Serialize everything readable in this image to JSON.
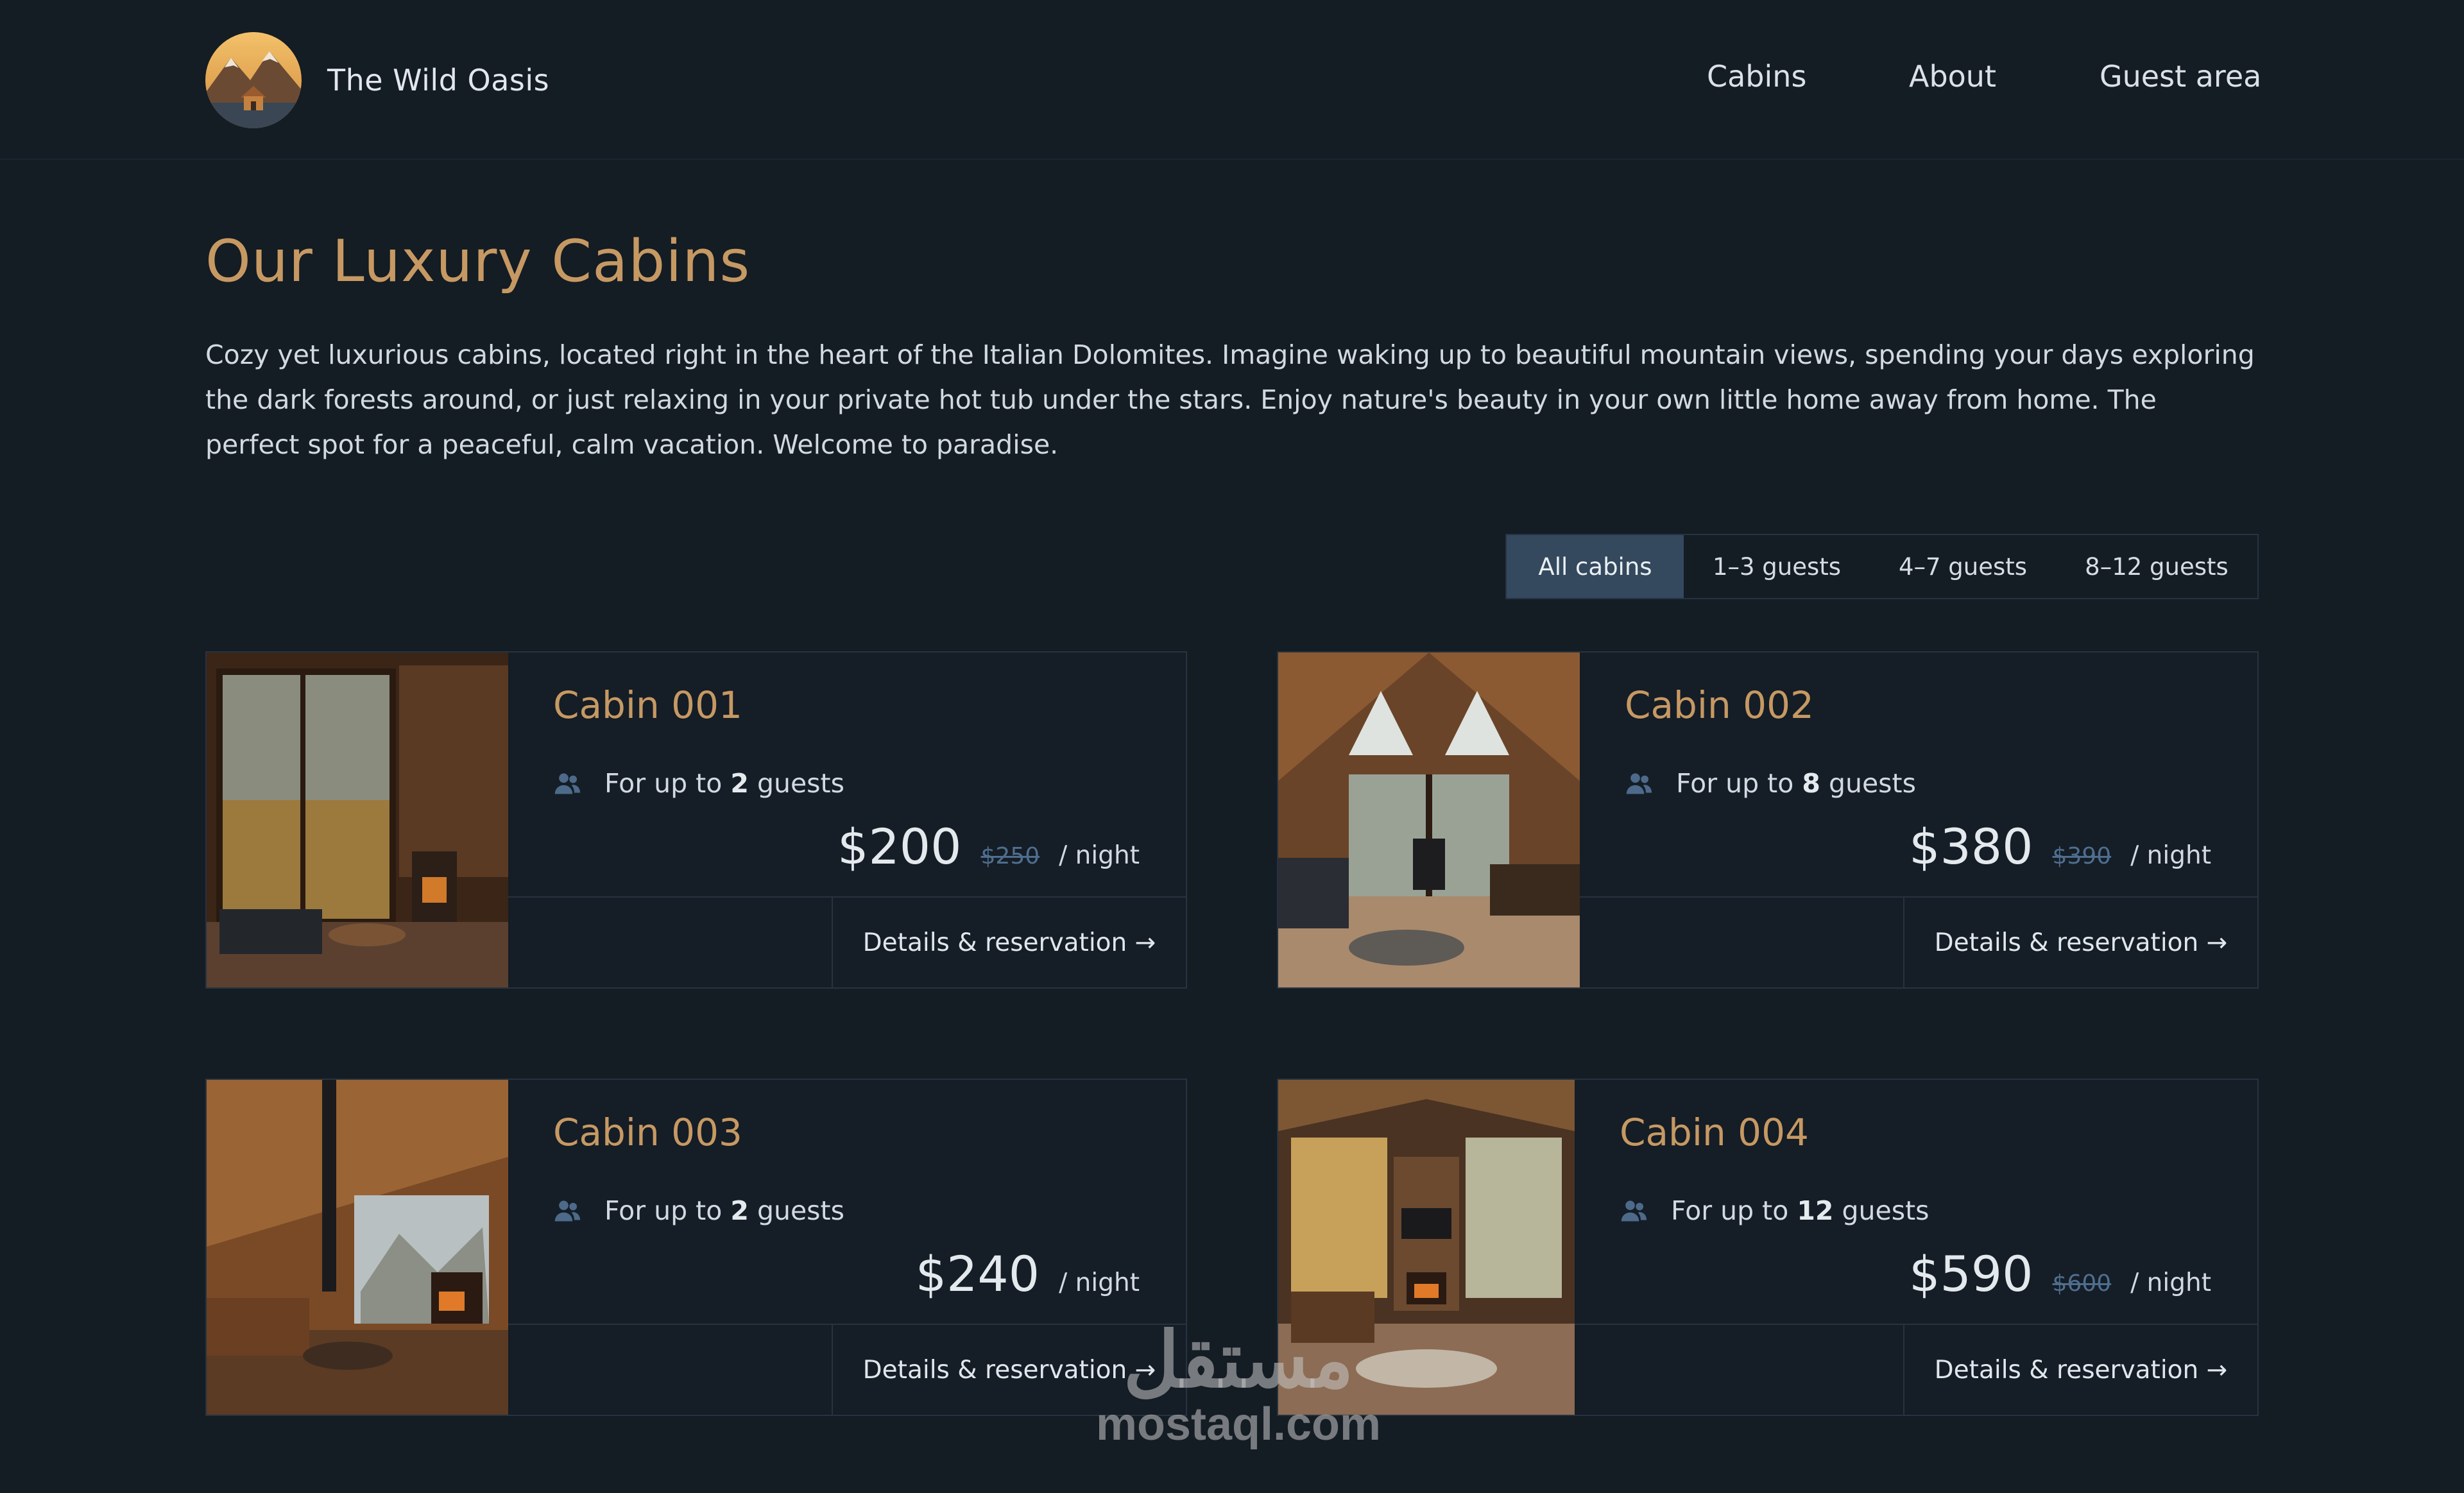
{
  "header": {
    "brand": "The Wild Oasis",
    "nav": {
      "cabins": "Cabins",
      "about": "About",
      "guest_area": "Guest area"
    }
  },
  "intro": {
    "title": "Our Luxury Cabins",
    "text": "Cozy yet luxurious cabins, located right in the heart of the Italian Dolomites. Imagine waking up to beautiful mountain views, spending your days exploring the dark forests around, or just relaxing in your private hot tub under the stars. Enjoy nature's beauty in your own little home away from home. The perfect spot for a peaceful, calm vacation. Welcome to paradise."
  },
  "filter": {
    "selected": "All cabins",
    "options": [
      "All cabins",
      "1–3 guests",
      "4–7 guests",
      "8–12 guests"
    ]
  },
  "cabins": [
    {
      "name": "Cabin 001",
      "guests_prefix": "For up to",
      "guests": "2",
      "guests_suffix": "guests",
      "price": "$200",
      "regular_price": "$250",
      "per_night": "/ night",
      "link": "Details & reservation →"
    },
    {
      "name": "Cabin 002",
      "guests_prefix": "For up to",
      "guests": "8",
      "guests_suffix": "guests",
      "price": "$380",
      "regular_price": "$390",
      "per_night": "/ night",
      "link": "Details & reservation →"
    },
    {
      "name": "Cabin 003",
      "guests_prefix": "For up to",
      "guests": "2",
      "guests_suffix": "guests",
      "price": "$240",
      "regular_price": "",
      "per_night": "/ night",
      "link": "Details & reservation →"
    },
    {
      "name": "Cabin 004",
      "guests_prefix": "For up to",
      "guests": "12",
      "guests_suffix": "guests",
      "price": "$590",
      "regular_price": "$600",
      "per_night": "/ night",
      "link": "Details & reservation →"
    }
  ],
  "watermark": {
    "arabic": "مستقل",
    "latin": "mostaql.com"
  },
  "colors": {
    "background": "#141c24",
    "accent": "#c69963",
    "active_filter": "#34495e",
    "strikethrough": "#4f6e8e"
  },
  "icons": {
    "guests": "users-icon"
  }
}
